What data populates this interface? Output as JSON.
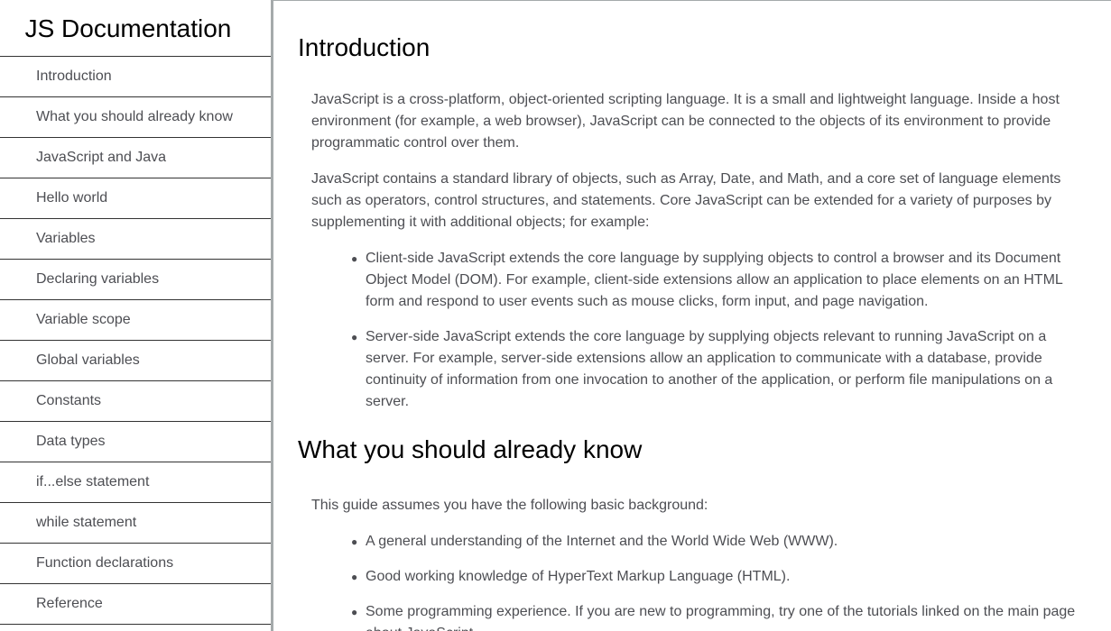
{
  "navbar": {
    "title": "JS Documentation",
    "items": [
      {
        "label": "Introduction",
        "name": "nav-link-introduction"
      },
      {
        "label": "What you should already know",
        "name": "nav-link-what-you-should-already-know"
      },
      {
        "label": "JavaScript and Java",
        "name": "nav-link-javascript-and-java"
      },
      {
        "label": "Hello world",
        "name": "nav-link-hello-world"
      },
      {
        "label": "Variables",
        "name": "nav-link-variables"
      },
      {
        "label": "Declaring variables",
        "name": "nav-link-declaring-variables"
      },
      {
        "label": "Variable scope",
        "name": "nav-link-variable-scope"
      },
      {
        "label": "Global variables",
        "name": "nav-link-global-variables"
      },
      {
        "label": "Constants",
        "name": "nav-link-constants"
      },
      {
        "label": "Data types",
        "name": "nav-link-data-types"
      },
      {
        "label": "if...else statement",
        "name": "nav-link-if-else-statement"
      },
      {
        "label": "while statement",
        "name": "nav-link-while-statement"
      },
      {
        "label": "Function declarations",
        "name": "nav-link-function-declarations"
      },
      {
        "label": "Reference",
        "name": "nav-link-reference"
      }
    ]
  },
  "main": {
    "introduction": {
      "title": "Introduction",
      "paragraphs": [
        "JavaScript is a cross-platform, object-oriented scripting language. It is a small and lightweight language. Inside a host environment (for example, a web browser), JavaScript can be connected to the objects of its environment to provide programmatic control over them.",
        "JavaScript contains a standard library of objects, such as Array, Date, and Math, and a core set of language elements such as operators, control structures, and statements. Core JavaScript can be extended for a variety of purposes by supplementing it with additional objects; for example:"
      ],
      "list": [
        "Client-side JavaScript extends the core language by supplying objects to control a browser and its Document Object Model (DOM). For example, client-side extensions allow an application to place elements on an HTML form and respond to user events such as mouse clicks, form input, and page navigation.",
        "Server-side JavaScript extends the core language by supplying objects relevant to running JavaScript on a server. For example, server-side extensions allow an application to communicate with a database, provide continuity of information from one invocation to another of the application, or perform file manipulations on a server."
      ]
    },
    "know": {
      "title": "What you should already know",
      "paragraphs": [
        "This guide assumes you have the following basic background:"
      ],
      "list": [
        "A general understanding of the Internet and the World Wide Web (WWW).",
        "Good working knowledge of HyperText Markup Language (HTML).",
        "Some programming experience. If you are new to programming, try one of the tutorials linked on the main page about JavaScript."
      ]
    }
  },
  "bullet_glyph": "●"
}
